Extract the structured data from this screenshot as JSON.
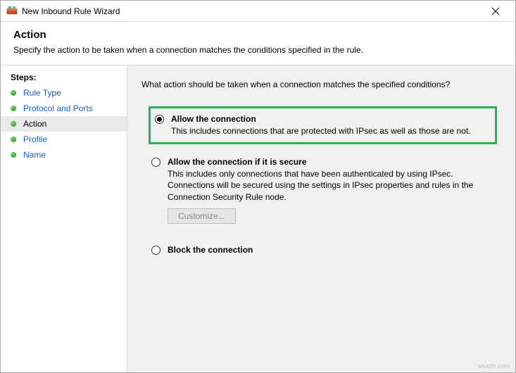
{
  "window": {
    "title": "New Inbound Rule Wizard"
  },
  "header": {
    "title": "Action",
    "description": "Specify the action to be taken when a connection matches the conditions specified in the rule."
  },
  "steps": {
    "title": "Steps:",
    "items": [
      {
        "label": "Rule Type",
        "active": false
      },
      {
        "label": "Protocol and Ports",
        "active": false
      },
      {
        "label": "Action",
        "active": true
      },
      {
        "label": "Profile",
        "active": false
      },
      {
        "label": "Name",
        "active": false
      }
    ]
  },
  "main": {
    "question": "What action should be taken when a connection matches the specified conditions?",
    "options": {
      "allow": {
        "label": "Allow the connection",
        "desc": "This includes connections that are protected with IPsec as well as those are not."
      },
      "allow_secure": {
        "label": "Allow the connection if it is secure",
        "desc": "This includes only connections that have been authenticated by using IPsec. Connections will be secured using the settings in IPsec properties and rules in the Connection Security Rule node.",
        "customize_label": "Customize..."
      },
      "block": {
        "label": "Block the connection"
      }
    }
  },
  "watermark": "wsxdn.com"
}
